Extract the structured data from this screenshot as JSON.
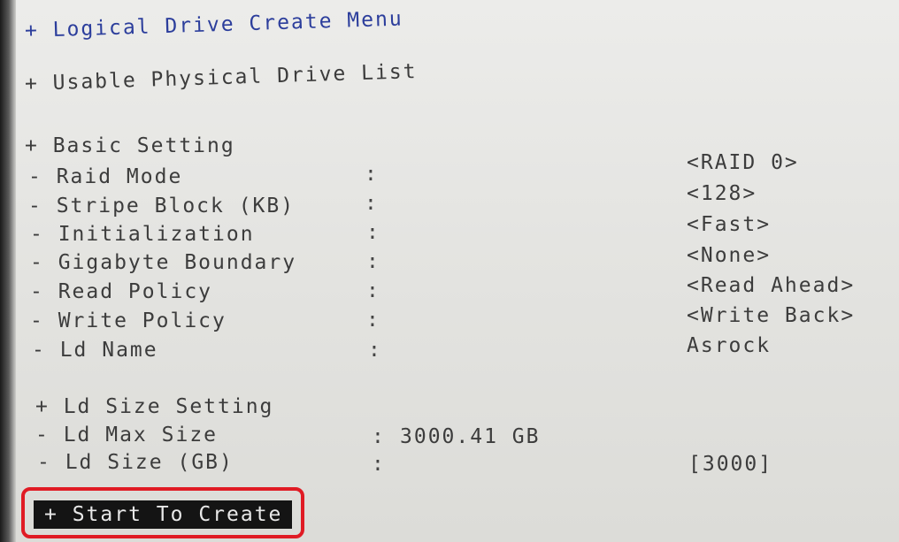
{
  "menu": {
    "logical_drive": "+ Logical Drive Create Menu",
    "usable_drives": "+ Usable Physical Drive List",
    "basic_setting": "+ Basic Setting",
    "ld_size_setting": "+ Ld Size Setting",
    "start_to_create": "+ Start To Create"
  },
  "basic": [
    {
      "label": "- Raid Mode",
      "value": "<RAID 0>"
    },
    {
      "label": "- Stripe Block (KB)",
      "value": "<128>"
    },
    {
      "label": "- Initialization",
      "value": "<Fast>"
    },
    {
      "label": "- Gigabyte Boundary",
      "value": "<None>"
    },
    {
      "label": "- Read Policy",
      "value": "<Read Ahead>"
    },
    {
      "label": "- Write Policy",
      "value": "<Write Back>"
    },
    {
      "label": "- Ld Name",
      "value": "Asrock"
    }
  ],
  "size": {
    "max_label": "- Ld Max Size",
    "max_value": "3000.41 GB",
    "size_label": "- Ld Size (GB)",
    "size_value": "[3000]"
  },
  "colon": ":",
  "colors": {
    "header": "#2c3e9c",
    "text": "#3c3c3c",
    "highlight": "#e01b24",
    "button_bg": "#141414"
  }
}
